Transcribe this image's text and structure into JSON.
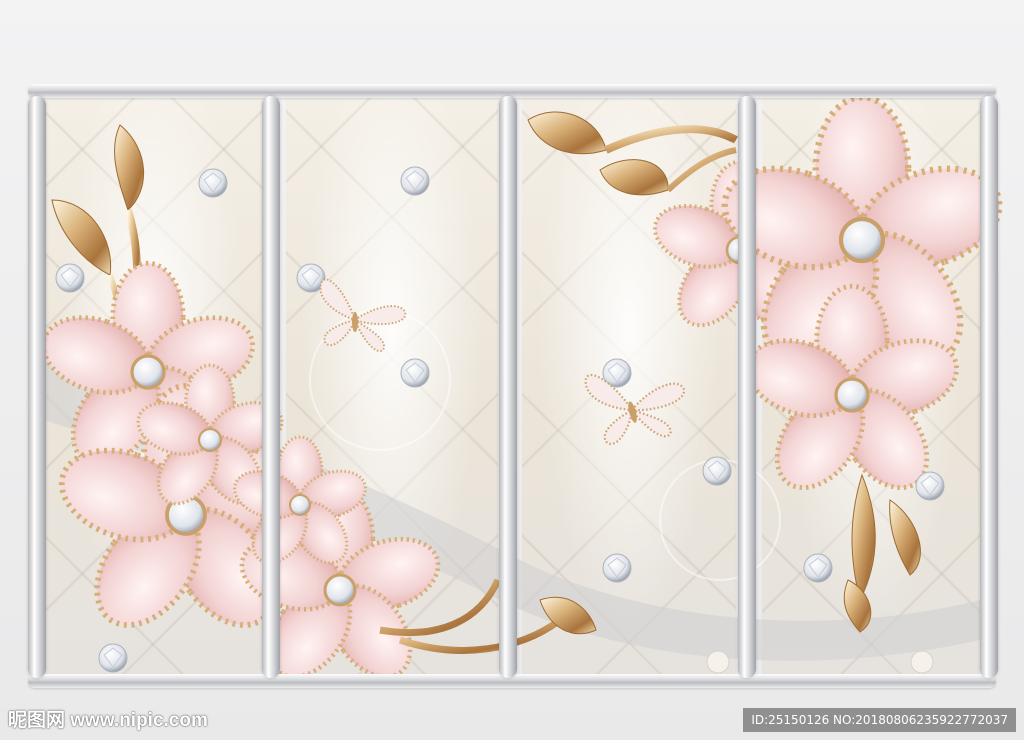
{
  "watermark": {
    "site_name": "昵图网 www.nipic.com",
    "image_id": "ID:25150126 NO:20180806235922772037"
  },
  "colors": {
    "frame_silver": "#d4d5d8",
    "panel_cream": "#f4efe6",
    "petal_pink": "#f3d3d3",
    "gold": "#c9a06a",
    "diamond": "#ffffff"
  },
  "panels": [
    {
      "name": "panel-1"
    },
    {
      "name": "panel-2"
    },
    {
      "name": "panel-3"
    },
    {
      "name": "panel-4"
    }
  ]
}
